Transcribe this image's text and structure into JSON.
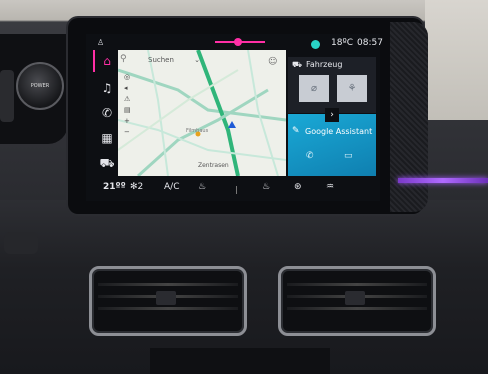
{
  "status_bar": {
    "temperature": "18ºC",
    "time": "08:57"
  },
  "map": {
    "search_label": "Suchen",
    "places": [
      "Zentrasen",
      "Filmhaus"
    ]
  },
  "vehicle_panel": {
    "title": "Fahrzeug"
  },
  "assistant_panel": {
    "title": "Google Assistant"
  },
  "bottom_bar": {
    "temperature": "21ºº",
    "fan_level": "2",
    "ac_label": "A/C"
  },
  "knob": {
    "label": "POWER"
  },
  "colors": {
    "accent_pink": "#ff2fa6",
    "assistant_blue": "#1aa9d6",
    "ambient_purple": "#a35cff",
    "status_teal": "#29d3c6"
  }
}
